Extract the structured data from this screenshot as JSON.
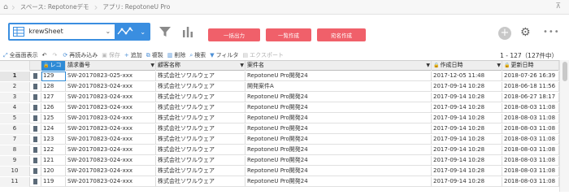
{
  "breadcrumb": {
    "space": "スペース: Repotoneデモ",
    "app": "アプリ: RepotoneU Pro"
  },
  "toolbar": {
    "view_name": "krewSheet",
    "buttons": {
      "bulk_output": "一括出力",
      "list_create": "一覧作成",
      "address_create": "宛名作成"
    },
    "icons": [
      "grid-icon",
      "chevron-down-icon",
      "graph-icon",
      "filter-icon",
      "bar-chart-icon",
      "plus-icon",
      "gear-icon",
      "more-icon"
    ]
  },
  "actionbar": {
    "fullscreen": "全画面表示",
    "reload": "再読み込み",
    "save": "保存",
    "add": "追加",
    "copy": "複製",
    "delete": "削除",
    "search": "検索",
    "filter": "フィルタ",
    "export": "エクスポート",
    "count": "1 - 127（127件中）"
  },
  "grid": {
    "headers": {
      "record": "レコ",
      "bill": "請求番号",
      "customer": "顧客名称",
      "case": "案件名",
      "created": "作成日時",
      "updated": "更新日時"
    },
    "rows": [
      {
        "n": "1",
        "rec": "129",
        "bill": "SW-20170823-025-xxx",
        "cust": "株式会社ソワルウェア",
        "case": "RepotoneU Pro開発24",
        "created": "2017-12-05 11:48",
        "updated": "2018-07-26 16:39"
      },
      {
        "n": "2",
        "rec": "128",
        "bill": "SW-20170823-024-xxx",
        "cust": "株式会社ソワルウェア",
        "case": "開発案件A",
        "created": "2017-09-14 10:28",
        "updated": "2018-06-18 11:56"
      },
      {
        "n": "3",
        "rec": "127",
        "bill": "SW-20170823-024-xxx",
        "cust": "株式会社ソワルウェア",
        "case": "RepotoneU Pro開発24",
        "created": "2017-09-14 10:28",
        "updated": "2018-06-27 18:17"
      },
      {
        "n": "4",
        "rec": "126",
        "bill": "SW-20170823-024-xxx",
        "cust": "株式会社ソワルウェア",
        "case": "RepotoneU Pro開発24",
        "created": "2017-09-14 10:28",
        "updated": "2018-08-03 11:08"
      },
      {
        "n": "5",
        "rec": "125",
        "bill": "SW-20170823-024-xxx",
        "cust": "株式会社ソワルウェア",
        "case": "RepotoneU Pro開発24",
        "created": "2017-09-14 10:28",
        "updated": "2018-08-03 11:08"
      },
      {
        "n": "6",
        "rec": "124",
        "bill": "SW-20170823-024-xxx",
        "cust": "株式会社ソワルウェア",
        "case": "RepotoneU Pro開発24",
        "created": "2017-09-14 10:28",
        "updated": "2018-08-03 11:08"
      },
      {
        "n": "7",
        "rec": "123",
        "bill": "SW-20170823-024-xxx",
        "cust": "株式会社ソワルウェア",
        "case": "RepotoneU Pro開発24",
        "created": "2017-09-14 10:28",
        "updated": "2018-08-03 11:08"
      },
      {
        "n": "8",
        "rec": "122",
        "bill": "SW-20170823-024-xxx",
        "cust": "株式会社ソワルウェア",
        "case": "RepotoneU Pro開発24",
        "created": "2017-09-14 10:28",
        "updated": "2018-08-03 11:08"
      },
      {
        "n": "9",
        "rec": "121",
        "bill": "SW-20170823-024-xxx",
        "cust": "株式会社ソワルウェア",
        "case": "RepotoneU Pro開発24",
        "created": "2017-09-14 10:28",
        "updated": "2018-08-03 11:08"
      },
      {
        "n": "10",
        "rec": "120",
        "bill": "SW-20170823-024-xxx",
        "cust": "株式会社ソワルウェア",
        "case": "RepotoneU Pro開発24",
        "created": "2017-09-14 10:28",
        "updated": "2018-08-03 11:08"
      },
      {
        "n": "11",
        "rec": "119",
        "bill": "SW-20170823-024-xxx",
        "cust": "株式会社ソワルウェア",
        "case": "RepotoneU Pro開発24",
        "created": "2017-09-14 10:28",
        "updated": "2018-08-03 11:08"
      }
    ]
  },
  "colors": {
    "accent": "#3a8ee0",
    "button_red": "#f0606a",
    "header_bg": "#eeeeee"
  }
}
